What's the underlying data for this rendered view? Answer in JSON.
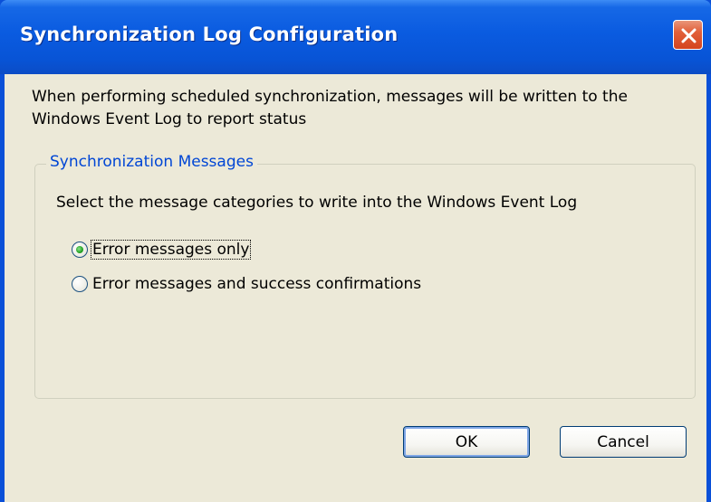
{
  "window": {
    "title": "Synchronization Log Configuration",
    "close_icon": "close-icon"
  },
  "intro_text": "When performing scheduled synchronization, messages will be written to the Windows Event Log to report status",
  "group": {
    "legend": "Synchronization Messages",
    "instruction": "Select the message categories to write into the Windows Event Log",
    "options": [
      {
        "label": "Error messages only",
        "selected": true
      },
      {
        "label": "Error messages and success confirmations",
        "selected": false
      }
    ]
  },
  "buttons": {
    "ok_label": "OK",
    "cancel_label": "Cancel"
  },
  "colors": {
    "titlebar": "#0a5be0",
    "legend_text": "#0046d5",
    "dialog_bg": "#ece9d8",
    "close_button": "#d4441f"
  }
}
